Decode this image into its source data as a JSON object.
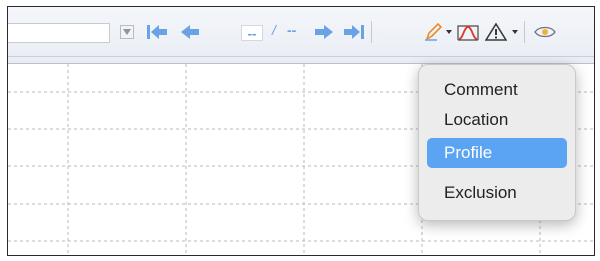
{
  "toolbar": {
    "range_value": "",
    "nav": {
      "first_icon": "skip-to-first-icon",
      "prev_icon": "previous-arrow-icon",
      "current": "--",
      "separator": "/",
      "total": "--",
      "next_icon": "next-arrow-icon",
      "last_icon": "skip-to-last-icon"
    },
    "tools": [
      {
        "name": "annotation-pencil-icon"
      },
      {
        "name": "profile-chart-icon"
      },
      {
        "name": "warning-triangle-icon"
      },
      {
        "name": "view-eye-icon"
      }
    ]
  },
  "menu": {
    "items": [
      {
        "label": "Comment",
        "selected": false
      },
      {
        "label": "Location",
        "selected": false
      },
      {
        "label": "Profile",
        "selected": true
      },
      {
        "label": "Exclusion",
        "selected": false
      }
    ]
  },
  "colors": {
    "nav_blue": "#6aa2e6",
    "menu_highlight": "#5aa4f3",
    "menu_bg": "#ececec",
    "pencil_orange": "#f08a24",
    "profile_red": "#e0392b"
  }
}
